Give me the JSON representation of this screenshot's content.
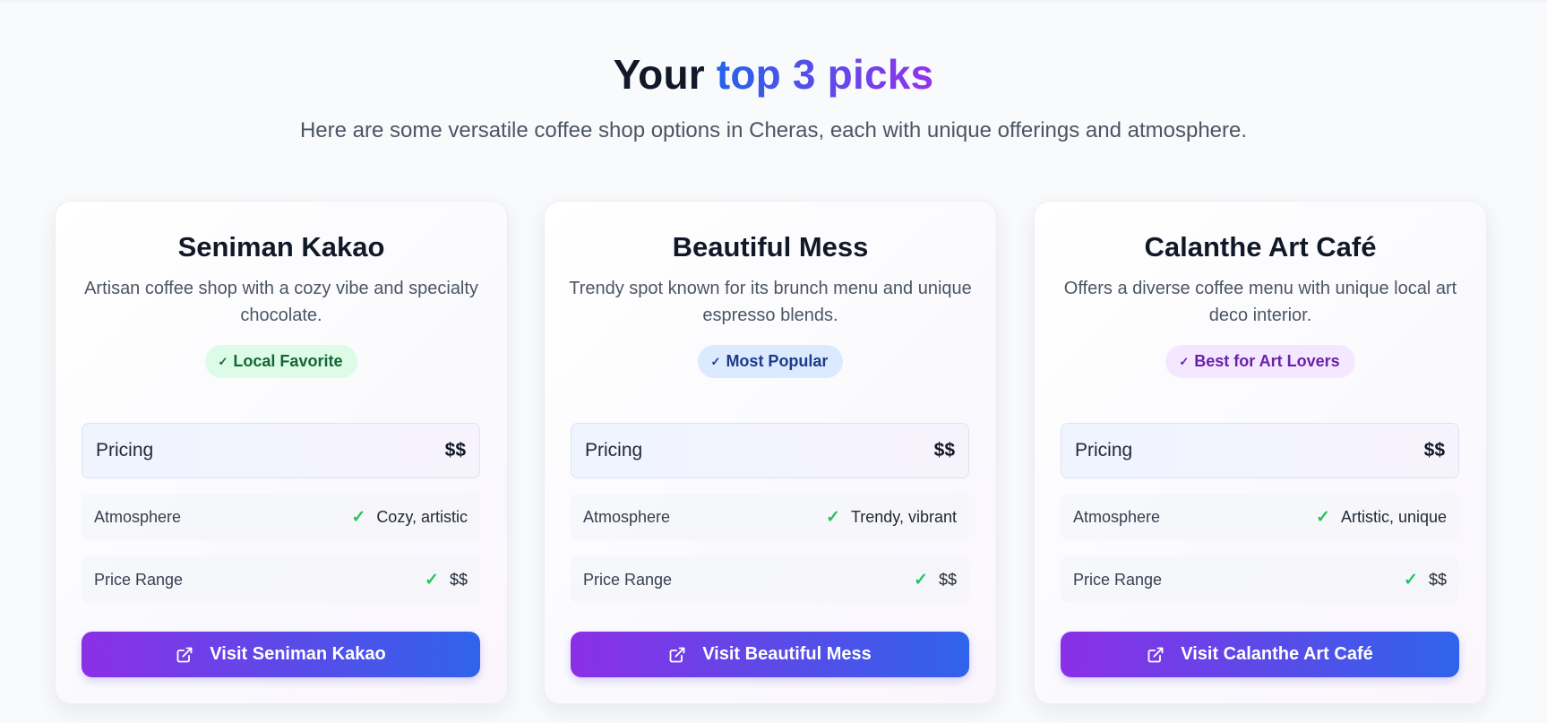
{
  "header": {
    "title_prefix": "Your ",
    "title_accent": "top 3 picks",
    "subtitle": "Here are some versatile coffee shop options in Cheras, each with unique offerings and atmosphere."
  },
  "cards": [
    {
      "name": "Seniman Kakao",
      "description": "Artisan coffee shop with a cozy vibe and specialty chocolate.",
      "badge": "Local Favorite",
      "badge_color": "#166534",
      "pricing_label": "Pricing",
      "pricing_value": "$$",
      "atmosphere_label": "Atmosphere",
      "atmosphere_value": "Cozy, artistic",
      "price_range_label": "Price Range",
      "price_range_value": "$$",
      "button_label": "Visit Seniman Kakao"
    },
    {
      "name": "Beautiful Mess",
      "description": "Trendy spot known for its brunch menu and unique espresso blends.",
      "badge": "Most Popular",
      "badge_color": "#1e3a8a",
      "pricing_label": "Pricing",
      "pricing_value": "$$",
      "atmosphere_label": "Atmosphere",
      "atmosphere_value": "Trendy, vibrant",
      "price_range_label": "Price Range",
      "price_range_value": "$$",
      "button_label": "Visit Beautiful Mess"
    },
    {
      "name": "Calanthe Art Café",
      "description": "Offers a diverse coffee menu with unique local art deco interior.",
      "badge": "Best for Art Lovers",
      "badge_color": "#6b21a8",
      "pricing_label": "Pricing",
      "pricing_value": "$$",
      "atmosphere_label": "Atmosphere",
      "atmosphere_value": "Artistic, unique",
      "price_range_label": "Price Range",
      "price_range_value": "$$",
      "button_label": "Visit Calanthe Art Café"
    }
  ],
  "colors": {
    "accent_gradient_start": "#2563eb",
    "accent_gradient_end": "#9333ea",
    "button_gradient_start": "#8b2fe6",
    "button_gradient_end": "#2f63eb",
    "check_green": "#22c55e"
  },
  "icons": {
    "badge_check": "check-icon",
    "row_check": "check-icon",
    "button_icon": "external-link-icon"
  }
}
